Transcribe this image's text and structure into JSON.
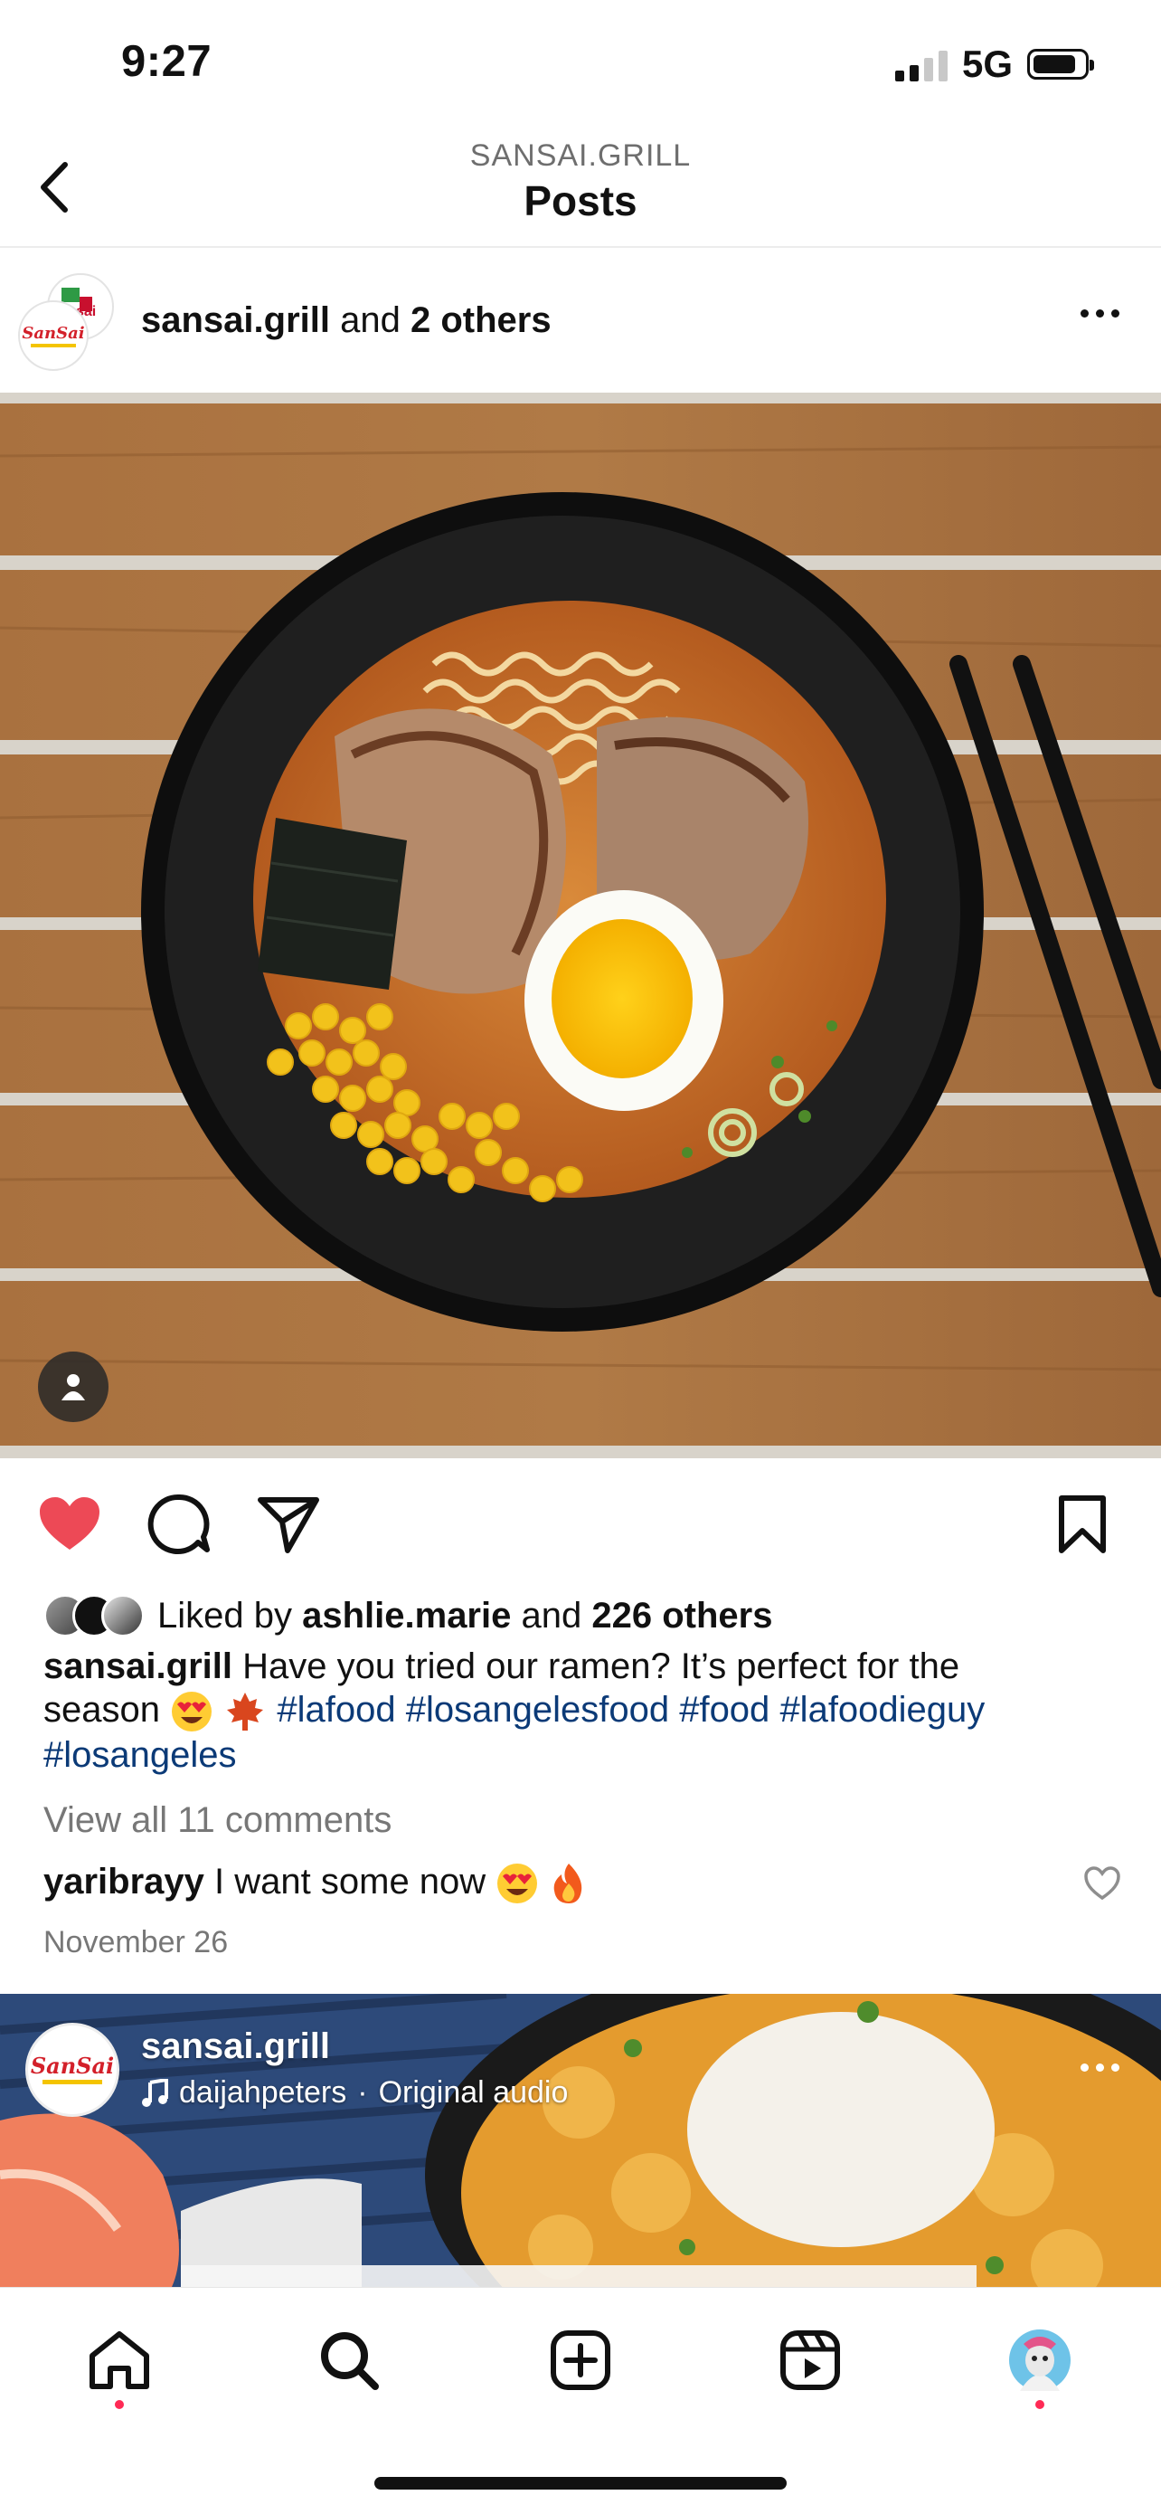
{
  "status_bar": {
    "time": "9:27",
    "network": "5G",
    "signal_bars": 2
  },
  "header": {
    "username": "SANSAI.GRILL",
    "title": "Posts"
  },
  "post": {
    "owner": "sansai.grill",
    "owner_suffix": "and",
    "collaborators": "2 others",
    "liked_by_prefix": "Liked by",
    "liked_by_user": "ashlie.marie",
    "liked_by_and": "and",
    "liked_by_count": "226 others",
    "caption_user": "sansai.grill",
    "caption_text_1": "Have you tried our ramen? It’s perfect for the",
    "caption_text_2": "season",
    "hashtags": [
      "#lafood",
      "#losangelesfood",
      "#food",
      "#lafoodieguy",
      "#losangeles"
    ],
    "view_comments": "View all 11 comments",
    "comment_user": "yaribrayy",
    "comment_text": "I want some now",
    "date": "November 26",
    "liked": true
  },
  "next_post": {
    "owner": "sansai.grill",
    "audio_user": "daijahpeters",
    "audio_separator": "·",
    "audio_label": "Original audio"
  },
  "logo": {
    "brand_text": "SanSai",
    "small_text": "sai"
  },
  "colors": {
    "like_red": "#ed4956",
    "hashtag": "#0b3a77",
    "notification_dot": "#ff2a55"
  },
  "tabs": [
    "home-tab",
    "search-tab",
    "create-tab",
    "reels-tab",
    "profile-tab"
  ]
}
